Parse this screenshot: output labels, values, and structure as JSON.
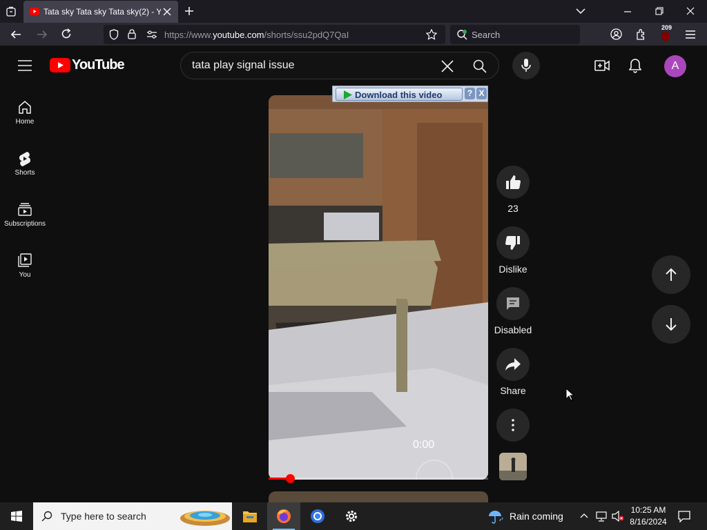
{
  "browser": {
    "tab_title": "Tata sky Tata sky Tata sky(2) - YouTube",
    "url_prefix": "https://www.",
    "url_domain": "youtube.com",
    "url_path": "/shorts/ssu2pdQ7QaI",
    "search_label": "Search",
    "extension_badge": "209"
  },
  "youtube": {
    "logo_text": "YouTube",
    "search_value": "tata play signal issue",
    "avatar_letter": "A",
    "sidebar": [
      {
        "label": "Home",
        "icon": "home-icon"
      },
      {
        "label": "Shorts",
        "icon": "shorts-icon"
      },
      {
        "label": "Subscriptions",
        "icon": "subscriptions-icon"
      },
      {
        "label": "You",
        "icon": "you-icon"
      }
    ],
    "video": {
      "time": "0:00",
      "progress": 0.1
    },
    "download_bar": {
      "label": "Download this video",
      "help": "?",
      "close": "X"
    },
    "actions": {
      "like_count": "23",
      "dislike_label": "Dislike",
      "comments_label": "Disabled",
      "share_label": "Share"
    }
  },
  "taskbar": {
    "search_placeholder": "Type here to search",
    "weather": "Rain coming",
    "time": "10:25 AM",
    "date": "8/16/2024"
  },
  "colors": {
    "youtube_red": "#ff0000",
    "avatar": "#ab47bc",
    "background": "#0f0f0f"
  }
}
